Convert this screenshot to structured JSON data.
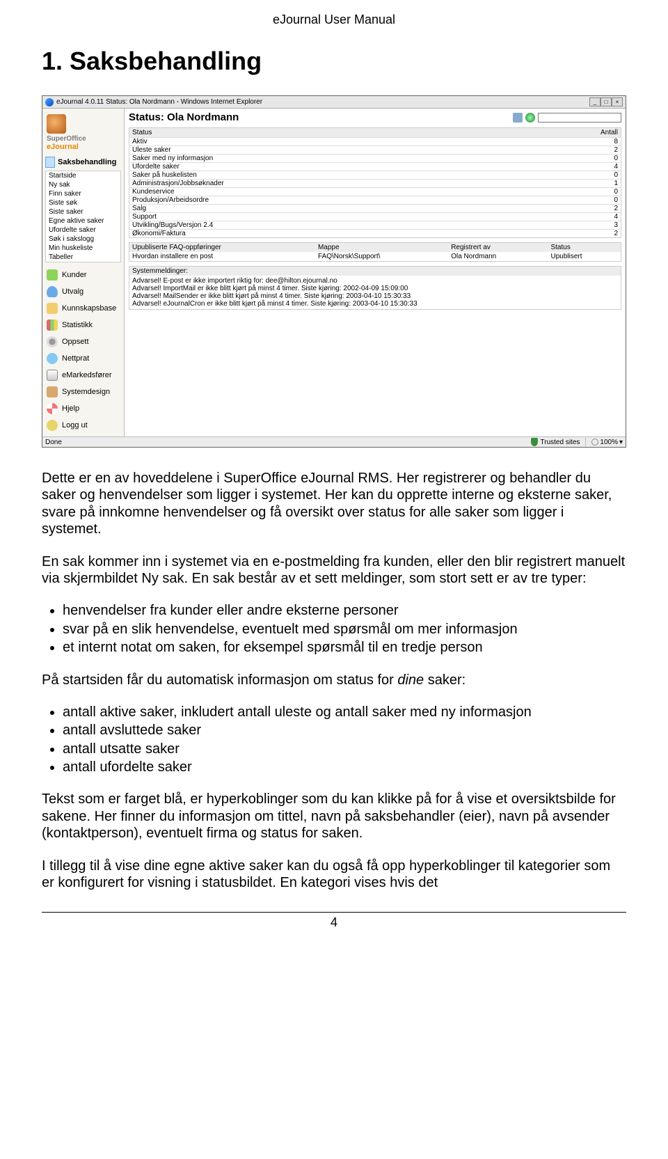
{
  "header": {
    "running": "eJournal User Manual"
  },
  "section": {
    "title": "1. Saksbehandling"
  },
  "footer": {
    "page": "4"
  },
  "screenshot": {
    "titlebar": "eJournal 4.0.11 Status: Ola Nordmann - Windows Internet Explorer",
    "win_btns": {
      "min": "_",
      "max": "□",
      "close": "×"
    },
    "brand": {
      "line1": "SuperOffice",
      "line2": "eJournal"
    },
    "sidebar": {
      "saksbehandling": {
        "title": "Saksbehandling",
        "items": [
          "Startside",
          "Ny sak",
          "Finn saker",
          "Siste søk",
          "Siste saker",
          "Egne aktive saker",
          "Ufordelte saker",
          "Søk i sakslogg",
          "Min huskeliste",
          "Tabeller"
        ]
      },
      "items": [
        {
          "icon": "i-green",
          "label": "Kunder"
        },
        {
          "icon": "i-blue",
          "label": "Utvalg"
        },
        {
          "icon": "i-folder",
          "label": "Kunnskapsbase"
        },
        {
          "icon": "i-stats",
          "label": "Statistikk"
        },
        {
          "icon": "i-gear",
          "label": "Oppsett"
        },
        {
          "icon": "i-chat",
          "label": "Nettprat"
        },
        {
          "icon": "i-mail",
          "label": "eMarkedsfører"
        },
        {
          "icon": "i-design",
          "label": "Systemdesign"
        },
        {
          "icon": "i-help",
          "label": "Hjelp"
        },
        {
          "icon": "i-exit",
          "label": "Logg ut"
        }
      ]
    },
    "content": {
      "heading": "Status: Ola Nordmann",
      "status_table": {
        "headers": [
          "Status",
          "Antall"
        ],
        "rows": [
          [
            "Aktiv",
            "8"
          ],
          [
            "Uleste saker",
            "2"
          ],
          [
            "Saker med ny informasjon",
            "0"
          ],
          [
            "Ufordelte saker",
            "4"
          ],
          [
            "Saker på huskelisten",
            "0"
          ],
          [
            "Administrasjon/Jobbsøknader",
            "1"
          ],
          [
            "Kundeservice",
            "0"
          ],
          [
            "Produksjon/Arbeidsordre",
            "0"
          ],
          [
            "Salg",
            "2"
          ],
          [
            "Support",
            "4"
          ],
          [
            "Utvikling/Bugs/Versjon 2.4",
            "3"
          ],
          [
            "Økonomi/Faktura",
            "2"
          ]
        ]
      },
      "faq_table": {
        "headers": [
          "Upubliserte FAQ-oppføringer",
          "Mappe",
          "Registrert av",
          "Status"
        ],
        "rows": [
          [
            "Hvordan installere en post",
            "FAQ\\Norsk\\Support\\",
            "Ola Nordmann",
            "Upublisert"
          ]
        ]
      },
      "sysmsg": {
        "title": "Systemmeldinger:",
        "lines": [
          "Advarsel! E-post er ikke importert riktig for: dee@hilton.ejournal.no",
          "Advarsel! ImportMail er ikke blitt kjørt på minst 4 timer. Siste kjøring: 2002-04-09 15:09:00",
          "Advarsel! MailSender er ikke blitt kjørt på minst 4 timer. Siste kjøring: 2003-04-10 15:30:33",
          "Advarsel! eJournalCron er ikke blitt kjørt på minst 4 timer. Siste kjøring: 2003-04-10 15:30:33"
        ]
      }
    },
    "statusbar": {
      "done": "Done",
      "trusted": "Trusted sites",
      "zoom": "100%"
    }
  },
  "body": {
    "p1": "Dette er en av hoveddelene i SuperOffice eJournal RMS. Her registrerer og behandler du saker og henvendelser som ligger i systemet. Her kan du opprette interne og eksterne saker, svare på innkomne henvendelser og få oversikt over status for alle saker som ligger i systemet.",
    "p2": "En sak kommer inn i systemet via en e-postmelding fra kunden, eller den blir registrert manuelt via skjermbildet Ny sak. En sak består av et sett meldinger, som stort sett er av tre typer:",
    "list1": [
      "henvendelser fra kunder eller andre eksterne personer",
      "svar på en slik henvendelse, eventuelt med spørsmål om mer informasjon",
      "et internt notat om saken, for eksempel spørsmål til en tredje person"
    ],
    "p3a": "På startsiden får du automatisk informasjon om status for ",
    "p3b": "dine",
    "p3c": " saker:",
    "list2": [
      "antall aktive saker, inkludert antall uleste og antall saker med ny informasjon",
      "antall avsluttede saker",
      "antall utsatte saker",
      "antall ufordelte saker"
    ],
    "p4": "Tekst som er farget blå, er hyperkoblinger som du kan klikke på for å vise et oversiktsbilde for sakene. Her finner du informasjon om tittel, navn på saksbehandler (eier), navn på avsender (kontaktperson), eventuelt firma og status for saken.",
    "p5": "I tillegg til å vise dine egne aktive saker kan du også få opp hyperkoblinger til kategorier som er konfigurert for visning i statusbildet. En kategori vises hvis det"
  }
}
